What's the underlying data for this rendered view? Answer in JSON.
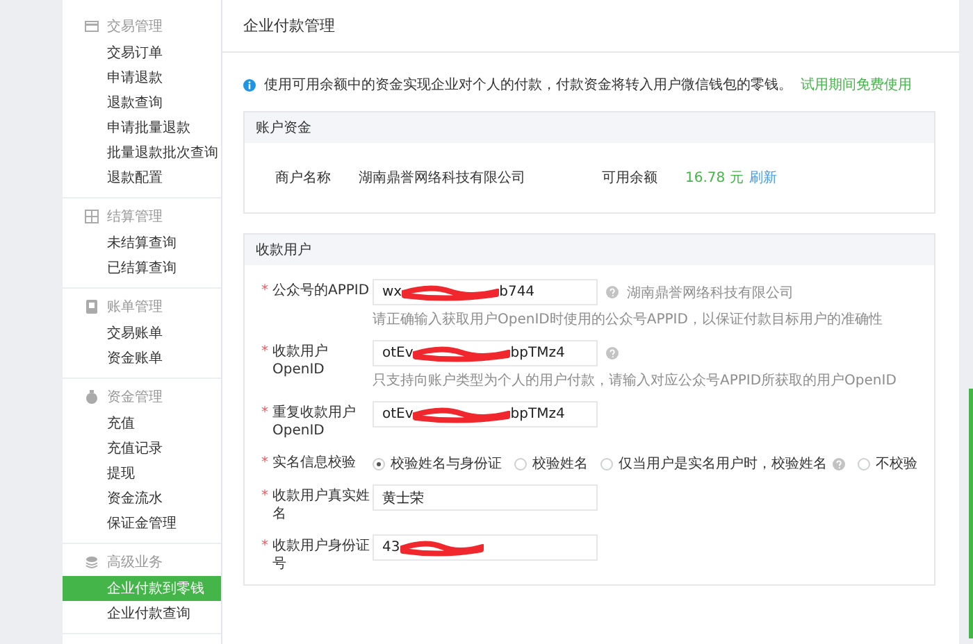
{
  "sidebar": {
    "groups": [
      {
        "title": "交易管理",
        "items": [
          {
            "label": "交易订单",
            "selected": false
          },
          {
            "label": "申请退款",
            "selected": false
          },
          {
            "label": "退款查询",
            "selected": false
          },
          {
            "label": "申请批量退款",
            "selected": false
          },
          {
            "label": "批量退款批次查询",
            "selected": false
          },
          {
            "label": "退款配置",
            "selected": false
          }
        ]
      },
      {
        "title": "结算管理",
        "items": [
          {
            "label": "未结算查询",
            "selected": false
          },
          {
            "label": "已结算查询",
            "selected": false
          }
        ]
      },
      {
        "title": "账单管理",
        "items": [
          {
            "label": "交易账单",
            "selected": false
          },
          {
            "label": "资金账单",
            "selected": false
          }
        ]
      },
      {
        "title": "资金管理",
        "items": [
          {
            "label": "充值",
            "selected": false
          },
          {
            "label": "充值记录",
            "selected": false
          },
          {
            "label": "提现",
            "selected": false
          },
          {
            "label": "资金流水",
            "selected": false
          },
          {
            "label": "保证金管理",
            "selected": false
          }
        ]
      },
      {
        "title": "高级业务",
        "items": [
          {
            "label": "企业付款到零钱",
            "selected": true
          },
          {
            "label": "企业付款查询",
            "selected": false
          }
        ]
      }
    ]
  },
  "page": {
    "title": "企业付款管理",
    "notice": {
      "text": "使用可用余额中的资金实现企业对个人的付款，付款资金将转入用户微信钱包的零钱。",
      "link": "试用期间免费使用"
    },
    "account": {
      "title": "账户资金",
      "merchant_label": "商户名称",
      "merchant_name": "湖南鼎誉网络科技有限公司",
      "balance_label": "可用余额",
      "balance": "16.78 元",
      "refresh": "刷新"
    },
    "recipient": {
      "title": "收款用户",
      "fields": [
        {
          "kind": "input",
          "required_mark": "*",
          "label": "公众号的APPID",
          "value_start": "wx",
          "value_end": "b744",
          "redacted": true,
          "help": true,
          "help_text": "湖南鼎誉网络科技有限公司",
          "hint": "请正确输入获取用户OpenID时使用的公众号APPID，以保证付款目标用户的准确性"
        },
        {
          "kind": "input",
          "required_mark": "*",
          "label": "收款用户OpenID",
          "value_start": "otEv",
          "value_end": "bpTMz4",
          "redacted": true,
          "help": true,
          "hint": "只支持向账户类型为个人的用户付款，请输入对应公众号APPID所获取的用户OpenID"
        },
        {
          "kind": "input",
          "required_mark": "*",
          "label": "重复收款用户OpenID",
          "value_start": "otEv",
          "value_end": "bpTMz4",
          "redacted": true
        },
        {
          "kind": "radio",
          "required_mark": "*",
          "label": "实名信息校验",
          "options": [
            {
              "label": "校验姓名与身份证",
              "selected": true
            },
            {
              "label": "校验姓名",
              "selected": false
            },
            {
              "label": "仅当用户是实名用户时，校验姓名",
              "selected": false,
              "help": true
            },
            {
              "label": "不校验",
              "selected": false
            }
          ]
        },
        {
          "kind": "input",
          "required_mark": "*",
          "label": "收款用户真实姓名",
          "value_start": "黄士荣"
        },
        {
          "kind": "input",
          "required_mark": "*",
          "label": "收款用户身份证号",
          "value_start": "43",
          "redacted": true
        }
      ]
    }
  }
}
